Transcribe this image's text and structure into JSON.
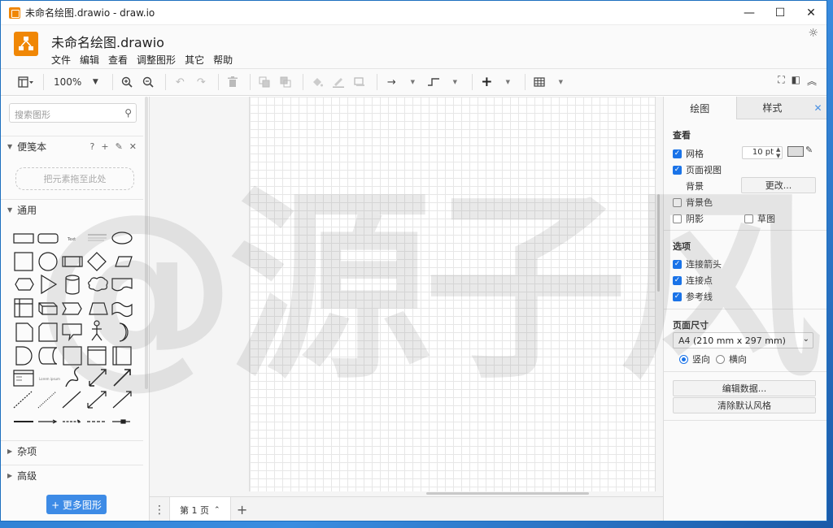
{
  "window": {
    "title": "未命名绘图.drawio - draw.io",
    "controls": [
      "—",
      "☐",
      "✕"
    ]
  },
  "app": {
    "filename": "未命名绘图.drawio",
    "menus": [
      "文件",
      "编辑",
      "查看",
      "调整图形",
      "其它",
      "帮助"
    ]
  },
  "toolbar": {
    "zoom": "100%"
  },
  "left_panel": {
    "search_placeholder": "搜索图形",
    "scratchpad": {
      "title": "便笺本",
      "drop_hint": "把元素拖至此处"
    },
    "general": {
      "title": "通用"
    },
    "misc": {
      "title": "杂项"
    },
    "advanced": {
      "title": "高级"
    },
    "more_shapes": "+ 更多图形"
  },
  "page_tabs": {
    "current": "第 1 页"
  },
  "right_panel": {
    "tabs": [
      "绘图",
      "样式"
    ],
    "view": {
      "title": "查看",
      "grid_label": "网格",
      "grid_size": "10 pt",
      "page_view_label": "页面视图",
      "background_label": "背景",
      "change_button": "更改...",
      "background_color_label": "背景色",
      "shadow_label": "阴影",
      "sketch_label": "草图"
    },
    "options": {
      "title": "选项",
      "connection_arrows": "连接箭头",
      "connection_points": "连接点",
      "guides": "参考线"
    },
    "page_size": {
      "title": "页面尺寸",
      "selected": "A4 (210 mm x 297 mm)",
      "portrait": "竖向",
      "landscape": "横向"
    },
    "edit_data_button": "编辑数据...",
    "clear_style_button": "清除默认风格"
  },
  "watermark": "@源子风",
  "colors": {
    "accent": "#f08705",
    "primary_button": "#3d8be6",
    "checkbox": "#1a73e8"
  }
}
